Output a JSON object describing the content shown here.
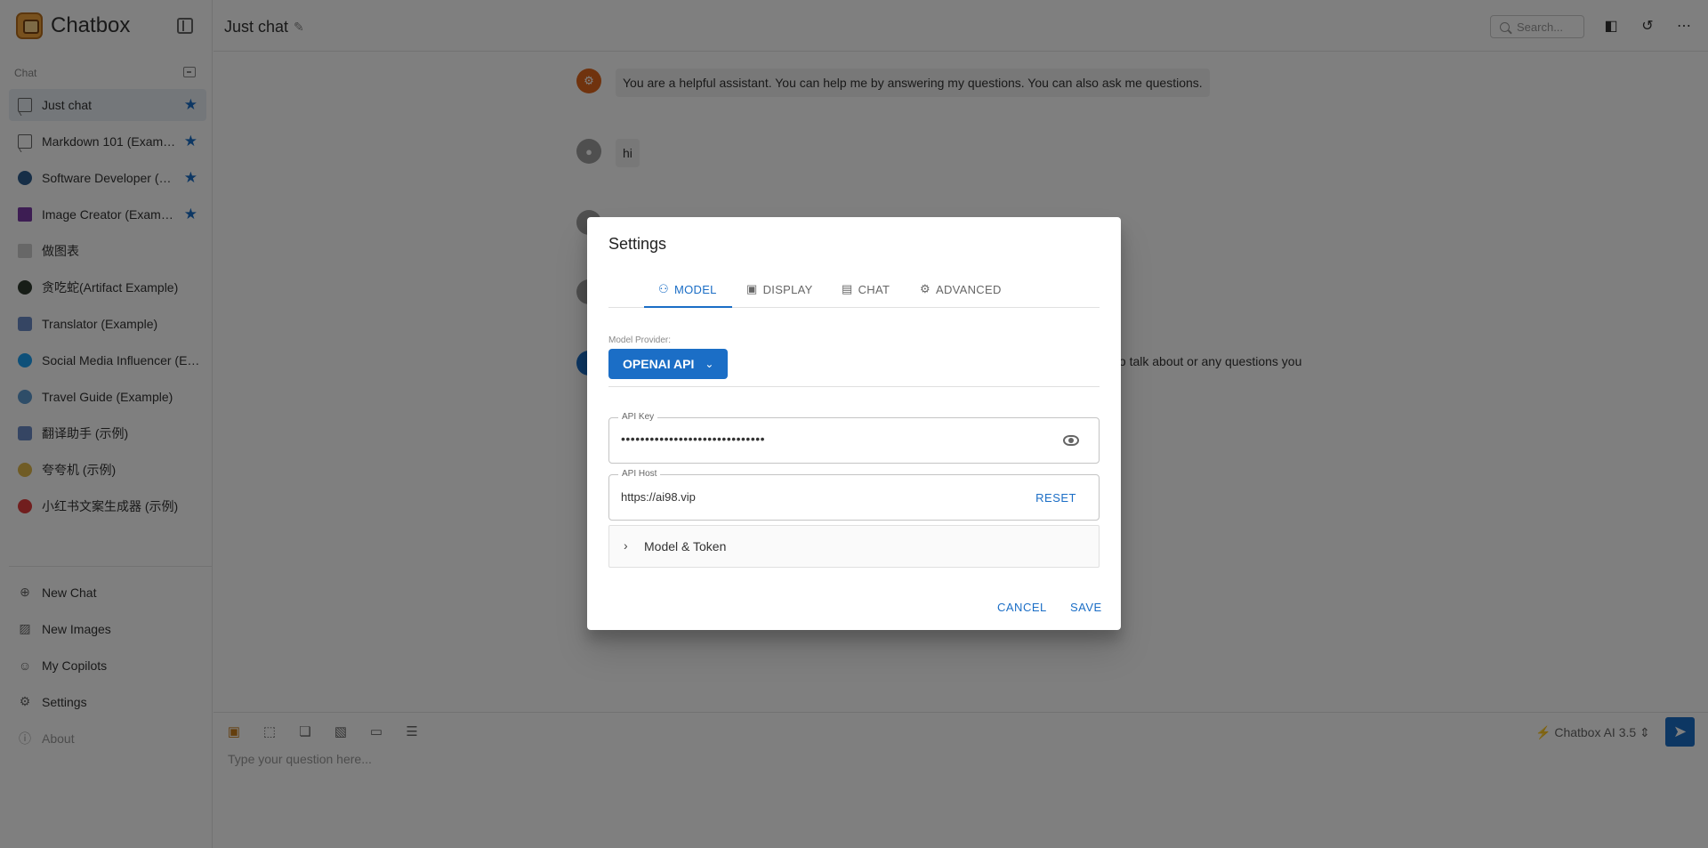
{
  "app": {
    "name": "Chatbox"
  },
  "sidebar": {
    "section_label": "Chat",
    "chats": [
      {
        "title": "Just chat",
        "icon": "chat-bubble-icon",
        "starred": true,
        "active": true
      },
      {
        "title": "Markdown 101 (Exam…",
        "icon": "chat-bubble-icon",
        "starred": true
      },
      {
        "title": "Software Developer (…",
        "icon": "avatar-icon",
        "starred": true,
        "color": "#2c5d8f"
      },
      {
        "title": "Image Creator (Exam…",
        "icon": "image-avatar-icon",
        "starred": true,
        "color": "#7a3aa6"
      },
      {
        "title": "做图表",
        "icon": "chart-avatar-icon",
        "color": "#cfcfcf"
      },
      {
        "title": "贪吃蛇(Artifact Example)",
        "icon": "snake-avatar-icon",
        "color": "#2f3b2f"
      },
      {
        "title": "Translator (Example)",
        "icon": "translator-avatar-icon",
        "color": "#6b8bc7"
      },
      {
        "title": "Social Media Influencer (E…",
        "icon": "twitter-avatar-icon",
        "color": "#1da1f2"
      },
      {
        "title": "Travel Guide (Example)",
        "icon": "globe-avatar-icon",
        "color": "#5c9ad0"
      },
      {
        "title": "翻译助手 (示例)",
        "icon": "translator-avatar-icon",
        "color": "#6b8bc7"
      },
      {
        "title": "夸夸机 (示例)",
        "icon": "party-avatar-icon",
        "color": "#e0b84a"
      },
      {
        "title": "小红书文案生成器 (示例)",
        "icon": "xiaohongshu-avatar-icon",
        "color": "#e23c3c"
      }
    ],
    "menu": [
      {
        "label": "New Chat",
        "icon": "plus-circle-icon"
      },
      {
        "label": "New Images",
        "icon": "add-image-icon"
      },
      {
        "label": "My Copilots",
        "icon": "robot-icon"
      },
      {
        "label": "Settings",
        "icon": "gear-icon"
      },
      {
        "label": "About",
        "icon": "info-icon",
        "dim": true
      }
    ]
  },
  "header": {
    "title": "Just chat",
    "search_placeholder": "Search..."
  },
  "messages": [
    {
      "role": "system",
      "text": "You are a helpful assistant. You can help me by answering my questions. You can also ask me questions."
    },
    {
      "role": "user",
      "text": "hi"
    },
    {
      "role": "assistant",
      "text": "to talk about or any questions you"
    }
  ],
  "composer": {
    "placeholder": "Type your question here...",
    "model": "Chatbox AI 3.5"
  },
  "dialog": {
    "title": "Settings",
    "tabs": [
      {
        "label": "MODEL",
        "icon": "robot-icon",
        "active": true
      },
      {
        "label": "DISPLAY",
        "icon": "display-icon"
      },
      {
        "label": "CHAT",
        "icon": "chat-icon"
      },
      {
        "label": "ADVANCED",
        "icon": "gear-icon"
      }
    ],
    "provider_label": "Model Provider:",
    "provider_value": "OPENAI API",
    "api_key": {
      "label": "API Key",
      "value": "••••••••••••••••••••••••••••••"
    },
    "api_host": {
      "label": "API Host",
      "value": "https://ai98.vip",
      "reset_label": "RESET"
    },
    "accordion_label": "Model & Token",
    "cancel_label": "CANCEL",
    "save_label": "SAVE"
  },
  "colors": {
    "accent": "#1b6ec6",
    "star": "#1b6ec6"
  }
}
